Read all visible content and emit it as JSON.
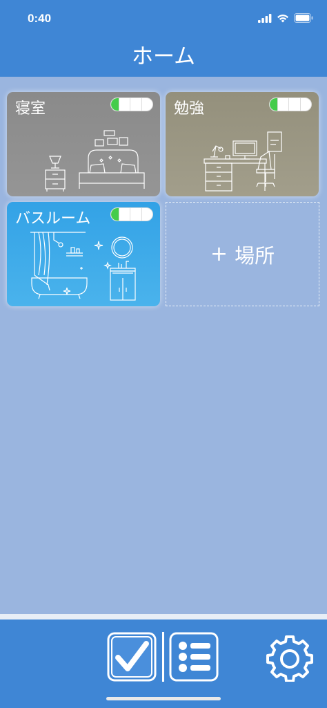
{
  "status_bar": {
    "time": "0:40"
  },
  "header": {
    "title": "ホーム"
  },
  "rooms": [
    {
      "name": "寝室",
      "icon": "bedroom-illustration-icon",
      "background": "#8e8e8e"
    },
    {
      "name": "勉強",
      "icon": "study-room-illustration-icon",
      "background": "#9a9684"
    },
    {
      "name": "バスルーム",
      "icon": "bathroom-illustration-icon",
      "background": "#3faae8"
    }
  ],
  "add_place": {
    "plus": "+",
    "label": "場所"
  },
  "tabbar": {
    "items": [
      {
        "icon": "checkbox-icon"
      },
      {
        "icon": "list-icon"
      },
      {
        "icon": "gear-icon"
      }
    ]
  },
  "colors": {
    "accent": "#3f86d5",
    "background": "#9ab5df",
    "toggle_on": "#44cc4a"
  }
}
